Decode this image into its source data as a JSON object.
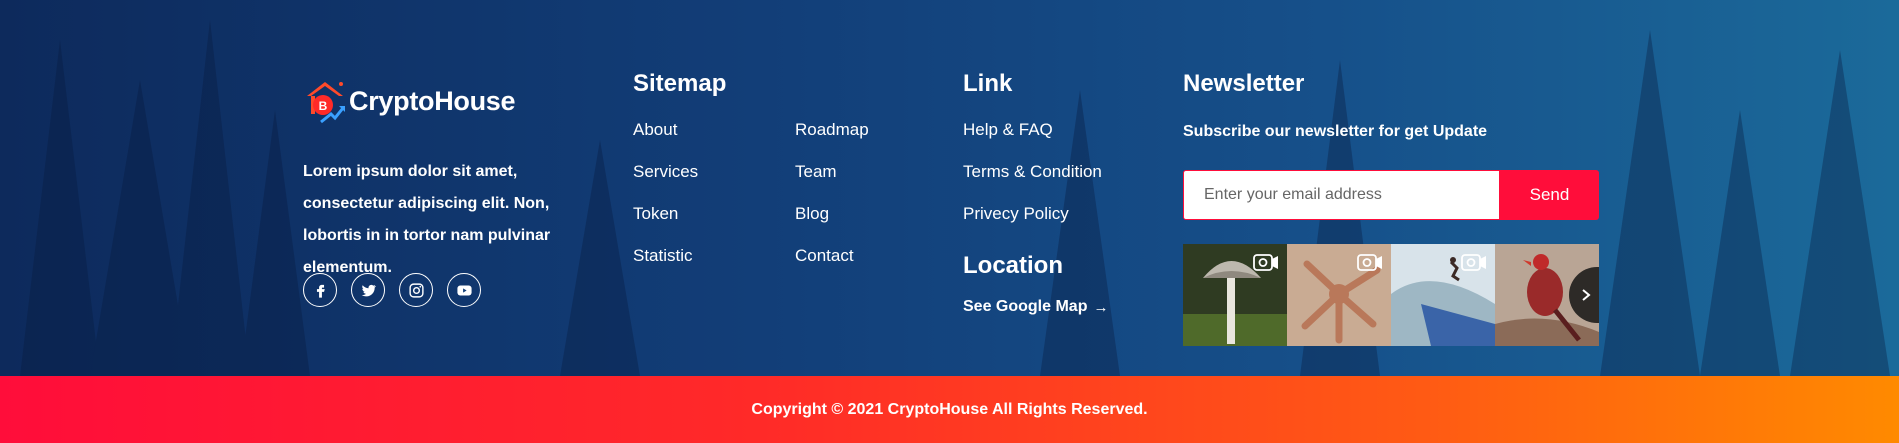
{
  "brand": {
    "name": "CryptoHouse",
    "logo_letter": "B",
    "about": "Lorem ipsum dolor sit amet, consectetur adipiscing elit. Non, lobortis in in tortor nam pulvinar elementum."
  },
  "socials": [
    {
      "icon": "facebook-icon"
    },
    {
      "icon": "twitter-icon"
    },
    {
      "icon": "instagram-icon"
    },
    {
      "icon": "youtube-icon"
    }
  ],
  "sitemap": {
    "title": "Sitemap",
    "col1": [
      "About",
      "Services",
      "Token",
      "Statistic"
    ],
    "col2": [
      "Roadmap",
      "Team",
      "Blog",
      "Contact"
    ]
  },
  "links": {
    "title": "Link",
    "items": [
      "Help & FAQ",
      "Terms & Condition",
      "Privecy Policy"
    ]
  },
  "location": {
    "title": "Location",
    "map_link": "See Google Map",
    "arrow": "→"
  },
  "newsletter": {
    "title": "Newsletter",
    "subtitle": "Subscribe our newsletter for get Update",
    "placeholder": "Enter your email address",
    "send_label": "Send"
  },
  "gallery": {
    "images": [
      "mushroom",
      "starfish",
      "wave-surfer",
      "bird"
    ],
    "next_icon": "chevron-right-icon"
  },
  "footer": {
    "copyright": "Copyright © 2021 CryptoHouse All Rights Reserved."
  },
  "colors": {
    "accent": "#ff0d3a",
    "gradient_end": "#ff8a00",
    "background_dark": "#0d2a5c"
  }
}
